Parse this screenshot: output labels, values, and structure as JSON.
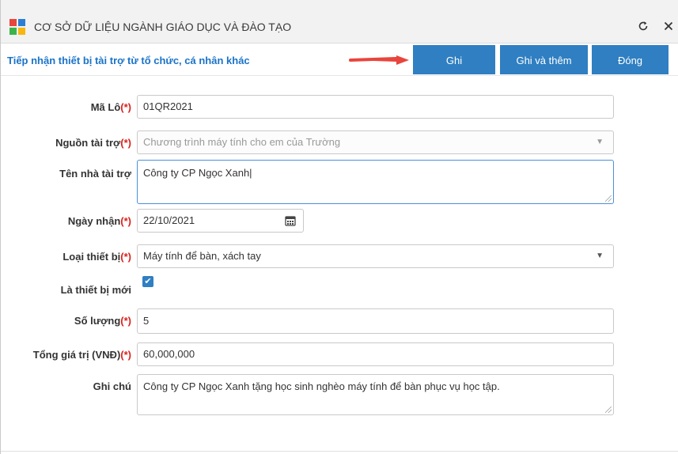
{
  "window": {
    "title": "CƠ SỞ DỮ LIỆU NGÀNH GIÁO DỤC VÀ ĐÀO TẠO"
  },
  "icons": {
    "refresh": "refresh-icon",
    "close": "close-icon",
    "calendar": "calendar-icon",
    "dropdown": "chevron-down-icon",
    "arrow": "arrow-right-icon"
  },
  "colors": {
    "accent": "#2f7fc2",
    "required": "#d9221c",
    "link": "#1a73c8",
    "arrow": "#e8453c"
  },
  "header": {
    "title": "Tiếp nhận thiết bị tài trợ từ tổ chức, cá nhân khác",
    "buttons": {
      "save": "Ghi",
      "save_add": "Ghi và thêm",
      "close": "Đóng"
    }
  },
  "form": {
    "required_marker": "(*)",
    "ma_lo": {
      "label": "Mã Lô",
      "value": "01QR2021"
    },
    "nguon_tai_tro": {
      "label": "Nguồn tài trợ",
      "value": "Chương trình máy tính cho em của Trường"
    },
    "ten_nha_tai_tro": {
      "label": "Tên nhà tài trợ",
      "value": "Công ty CP Ngọc Xanh"
    },
    "ngay_nhan": {
      "label": "Ngày nhận",
      "value": "22/10/2021"
    },
    "loai_thiet_bi": {
      "label": "Loại thiết bị",
      "value": "Máy tính để bàn, xách tay"
    },
    "la_thiet_bi_moi": {
      "label": "Là thiết bị mới",
      "checked": true
    },
    "so_luong": {
      "label": "Số lượng",
      "value": "5"
    },
    "tong_gia_tri": {
      "label": "Tổng giá trị (VNĐ)",
      "value": "60,000,000"
    },
    "ghi_chu": {
      "label": "Ghi chú",
      "value": "Công ty CP Ngọc Xanh tặng học sinh nghèo máy tính để bàn phục vụ học tập."
    }
  }
}
